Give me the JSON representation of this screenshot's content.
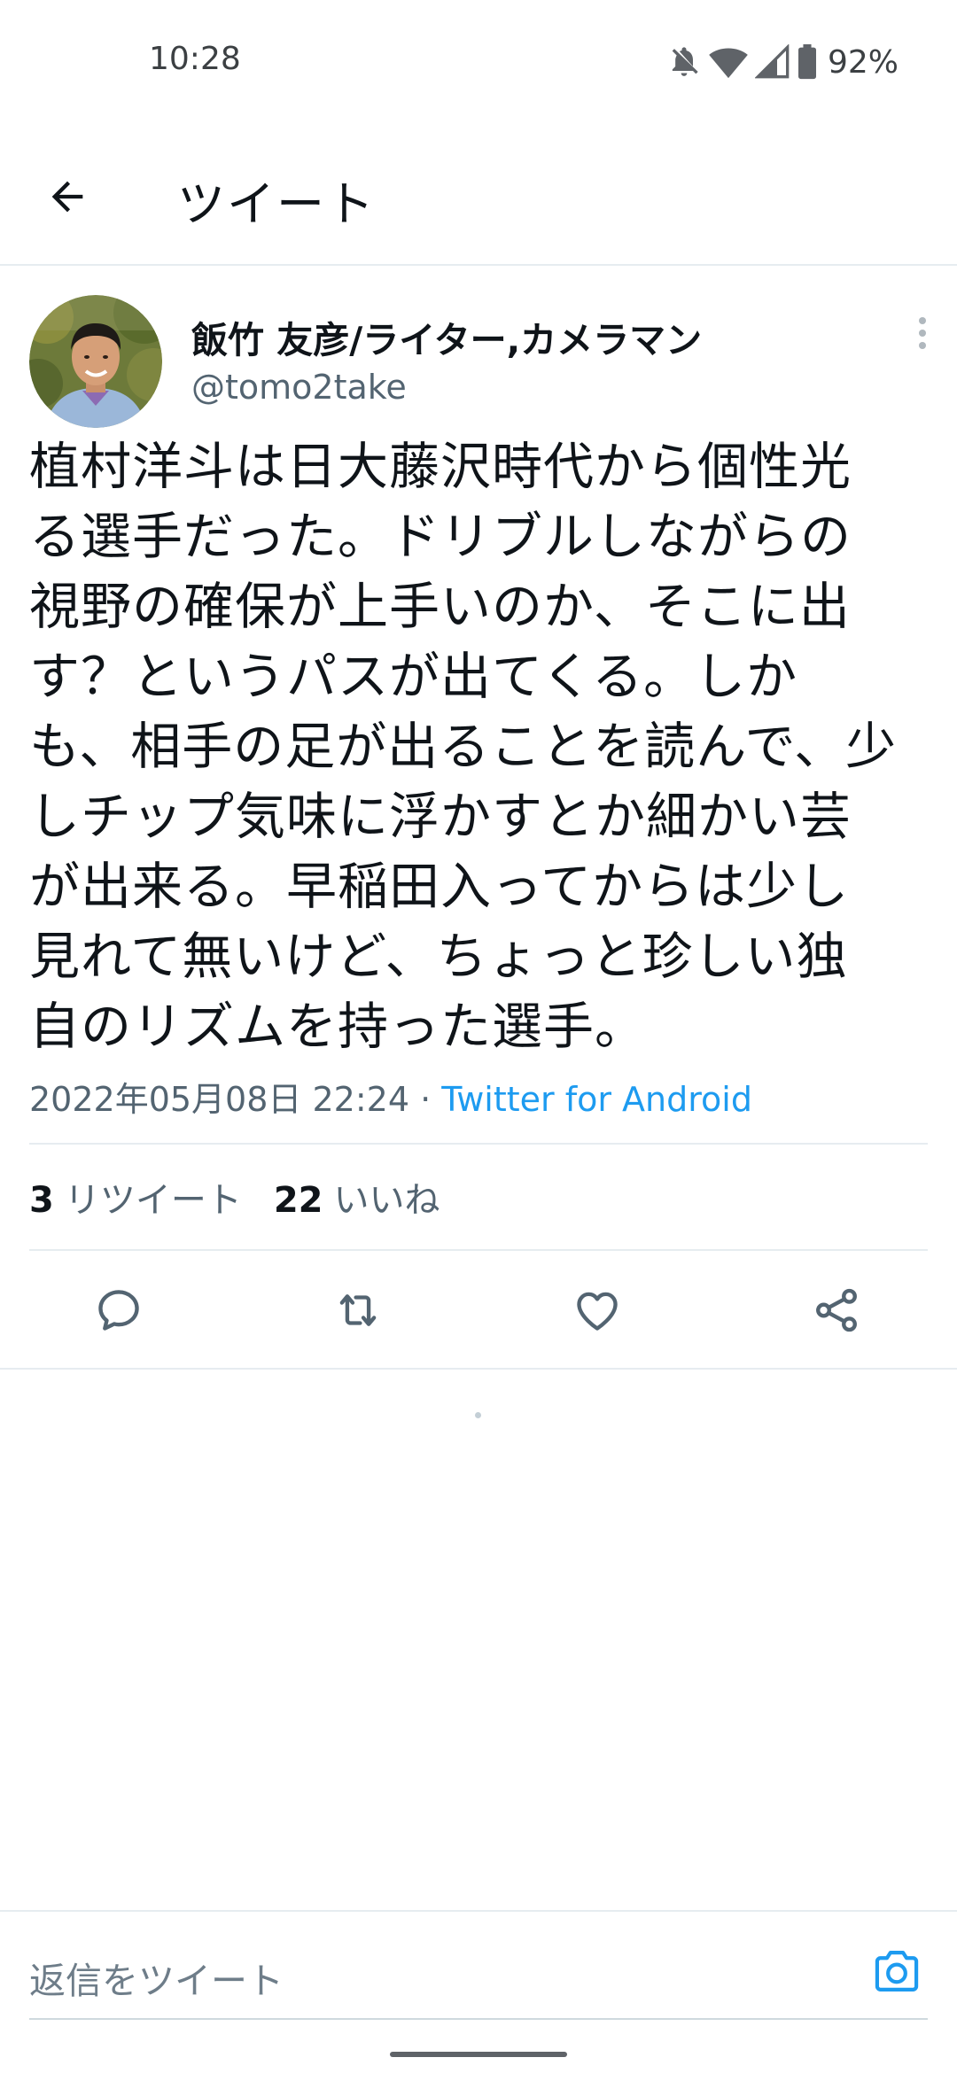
{
  "status_bar": {
    "time": "10:28",
    "battery": "92%",
    "icons": [
      "bell-off-icon",
      "wifi-icon",
      "signal-icon",
      "battery-icon"
    ]
  },
  "app_bar": {
    "title": "ツイート",
    "back_icon": "arrow-left-icon"
  },
  "tweet": {
    "author_name": "飯竹 友彦/ライター,カメラマン",
    "author_handle": "@tomo2take",
    "text_lines": [
      "植村洋斗は日大藤沢時代から個性光",
      "る選手だった。ドリブルしながらの",
      "視野の確保が上手いのか、そこに出",
      "す？というパスが出てくる。しか",
      "も、相手の足が出ることを読んで、少",
      "しチップ気味に浮かすとか細かい芸",
      "が出来る。早稲田入ってからは少し",
      "見れて無いけど、ちょっと珍しい独",
      "自のリズムを持った選手。"
    ],
    "timestamp": "2022年05月08日 22:24",
    "separator": " · ",
    "source": "Twitter for Android",
    "retweet_count": "3",
    "retweet_label": "リツイート",
    "like_count": "22",
    "like_label": "いいね"
  },
  "actions": [
    "reply-icon",
    "retweet-icon",
    "like-icon",
    "share-icon"
  ],
  "reply_bar": {
    "placeholder": "返信をツイート",
    "camera_icon": "camera-icon"
  },
  "colors": {
    "accent": "#1d9bf0",
    "text_primary": "#0f1419",
    "text_secondary": "#536471",
    "divider": "#e6ecf0"
  }
}
